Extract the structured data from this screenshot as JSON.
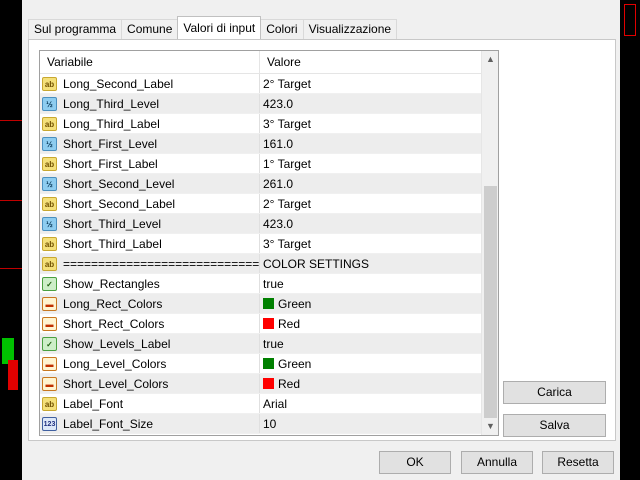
{
  "tabs": [
    {
      "label": "Sul programma"
    },
    {
      "label": "Comune"
    },
    {
      "label": "Valori di input",
      "active": true
    },
    {
      "label": "Colori"
    },
    {
      "label": "Visualizzazione"
    }
  ],
  "grid": {
    "col_variable": "Variabile",
    "col_value": "Valore",
    "rows": [
      {
        "icon": "ab",
        "name": "Long_Second_Label",
        "value": "2° Target"
      },
      {
        "icon": "num",
        "name": "Long_Third_Level",
        "value": "423.0"
      },
      {
        "icon": "ab",
        "name": "Long_Third_Label",
        "value": "3° Target"
      },
      {
        "icon": "num",
        "name": "Short_First_Level",
        "value": "161.0"
      },
      {
        "icon": "ab",
        "name": "Short_First_Label",
        "value": "1° Target"
      },
      {
        "icon": "num",
        "name": "Short_Second_Level",
        "value": "261.0"
      },
      {
        "icon": "ab",
        "name": "Short_Second_Label",
        "value": "2° Target"
      },
      {
        "icon": "num",
        "name": "Short_Third_Level",
        "value": "423.0"
      },
      {
        "icon": "ab",
        "name": "Short_Third_Label",
        "value": "3° Target"
      },
      {
        "icon": "ab",
        "name": "================================",
        "value": "COLOR SETTINGS"
      },
      {
        "icon": "bool",
        "name": "Show_Rectangles",
        "value": "true"
      },
      {
        "icon": "col",
        "name": "Long_Rect_Colors",
        "value": "Green",
        "swatch": "#008000"
      },
      {
        "icon": "col",
        "name": "Short_Rect_Colors",
        "value": "Red",
        "swatch": "#ff0000"
      },
      {
        "icon": "bool",
        "name": "Show_Levels_Label",
        "value": "true"
      },
      {
        "icon": "col",
        "name": "Long_Level_Colors",
        "value": "Green",
        "swatch": "#008000"
      },
      {
        "icon": "col",
        "name": "Short_Level_Colors",
        "value": "Red",
        "swatch": "#ff0000"
      },
      {
        "icon": "ab",
        "name": "Label_Font",
        "value": "Arial"
      },
      {
        "icon": "int",
        "name": "Label_Font_Size",
        "value": "10"
      }
    ]
  },
  "icons": {
    "ab": {
      "glyph": "ab",
      "semantic": "string-param-icon"
    },
    "num": {
      "glyph": "½",
      "semantic": "double-param-icon"
    },
    "bool": {
      "glyph": "✓",
      "semantic": "bool-param-icon"
    },
    "col": {
      "glyph": "▬",
      "semantic": "color-param-icon"
    },
    "int": {
      "glyph": "123",
      "semantic": "int-param-icon"
    }
  },
  "buttons": {
    "carica": "Carica",
    "salva": "Salva",
    "ok": "OK",
    "annulla": "Annulla",
    "resetta": "Resetta"
  }
}
